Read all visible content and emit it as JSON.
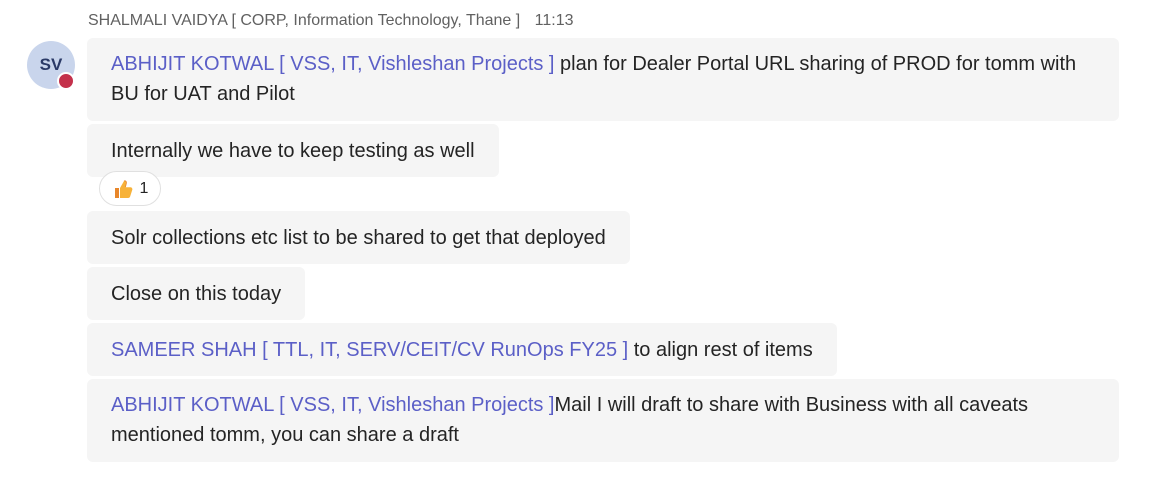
{
  "header": {
    "sender": "SHALMALI VAIDYA [ CORP, Information Technology, Thane ]",
    "time": "11:13"
  },
  "avatar": {
    "initials": "SV",
    "status_color": "#c4314b"
  },
  "messages": [
    {
      "mention": "ABHIJIT KOTWAL [ VSS, IT, Vishleshan Projects ]",
      "line1": " plan for Dealer Portal URL sharing of PROD for tomm with",
      "line2": "BU for UAT and Pilot"
    },
    {
      "text": "Internally we have to keep testing as well"
    },
    {
      "text": "Solr collections etc list to be shared to get that deployed"
    },
    {
      "text": "Close on this today"
    },
    {
      "mention": "SAMEER SHAH [ TTL, IT, SERV/CEIT/CV RunOps FY25 ]",
      "text": " to align rest of items"
    },
    {
      "mention": "ABHIJIT KOTWAL [ VSS, IT, Vishleshan Projects ]",
      "line1": "Mail I will draft to share with Business with all caveats",
      "line2": "mentioned tomm, you can share a draft"
    }
  ],
  "reaction": {
    "icon": "thumbs-up-icon",
    "count": "1"
  },
  "colors": {
    "mention": "#5b5fc7",
    "bubble": "#f5f5f5",
    "meta_text": "#616161"
  }
}
